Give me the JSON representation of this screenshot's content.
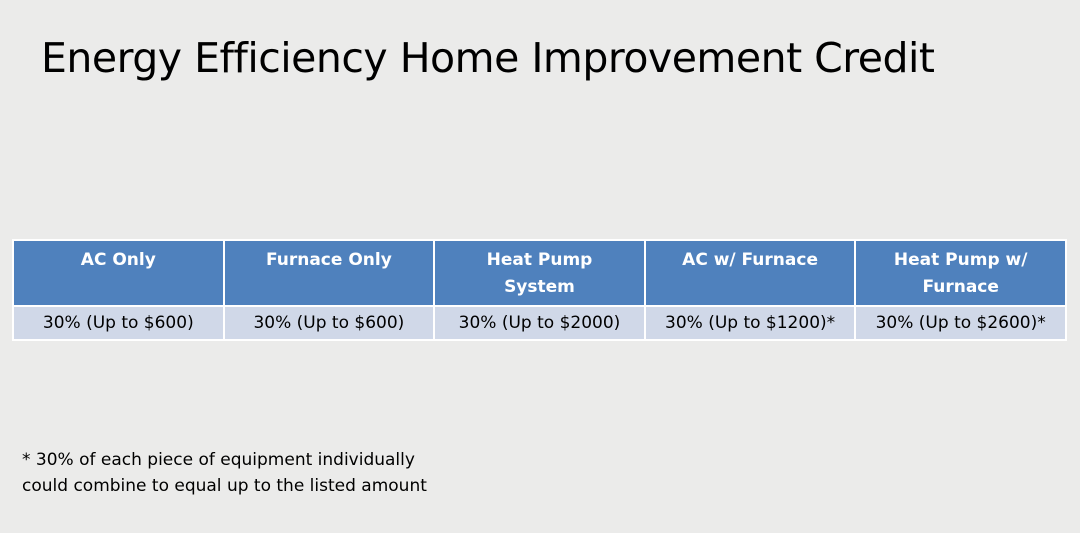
{
  "title": "Energy Efficiency Home Improvement Credit",
  "table": {
    "headers": [
      "AC Only",
      "Furnace Only",
      "Heat Pump System",
      "AC w/ Furnace",
      "Heat Pump w/ Furnace"
    ],
    "rows": [
      [
        "30% (Up to $600)",
        "30% (Up to $600)",
        "30% (Up to $2000)",
        "30% (Up to $1200)*",
        "30% (Up to $2600)*"
      ]
    ]
  },
  "footnote": {
    "line1": "* 30% of each piece of equipment individually",
    "line2": "could combine to equal up to the listed amount"
  },
  "colors": {
    "header_bg": "#4f81bd",
    "row_bg": "#d0d8e8",
    "page_bg": "#ebebea"
  }
}
